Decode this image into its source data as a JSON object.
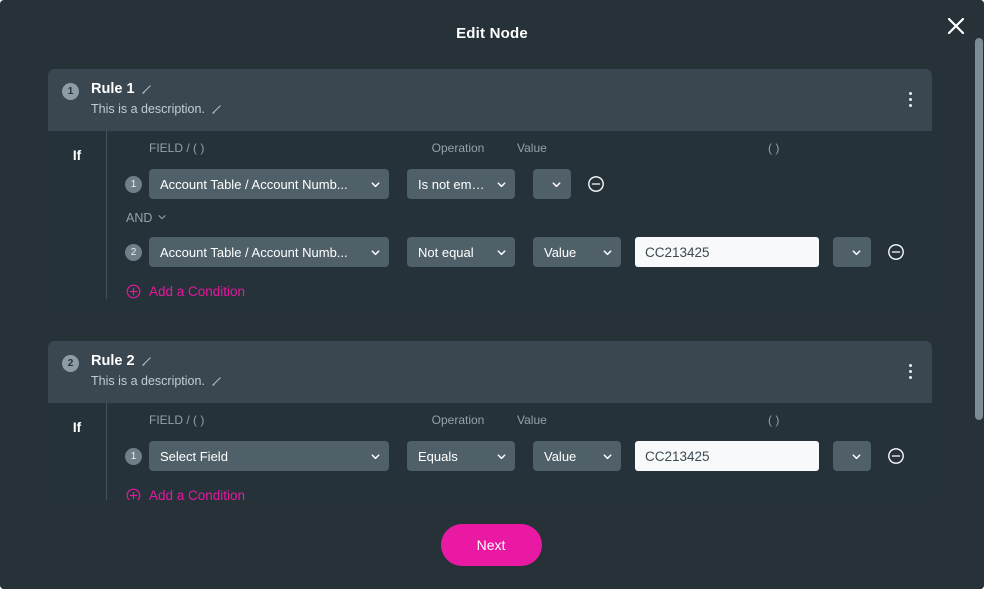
{
  "dialog": {
    "title": "Edit Node",
    "close_icon": "close-icon"
  },
  "colors": {
    "accent": "#ea19a3",
    "dialog_bg": "#263238",
    "rule_header_bg": "#3a4750",
    "select_bg": "#4f6069",
    "input_bg": "#f7f9fa"
  },
  "columns": {
    "field": "FIELD / ( )",
    "operation": "Operation",
    "value": "Value",
    "paren": "( )"
  },
  "if_label": "If",
  "add_condition_label": "Add a Condition",
  "connector": {
    "label": "AND"
  },
  "rules": [
    {
      "number": "1",
      "title": "Rule 1",
      "description": "This is a description.",
      "conditions": [
        {
          "number": "1",
          "field": "Account Table / Account Numb...",
          "operation": "Is not empty",
          "value_type": "",
          "value": "",
          "has_value_input": false,
          "value_type_is_chevron_only": true
        },
        {
          "number": "2",
          "field": "Account Table / Account Numb...",
          "operation": "Not equal",
          "value_type": "Value",
          "value": "CC213425",
          "has_value_input": true,
          "value_type_is_chevron_only": false
        }
      ]
    },
    {
      "number": "2",
      "title": "Rule 2",
      "description": "This is a description.",
      "conditions": [
        {
          "number": "1",
          "field": "Select Field",
          "operation": "Equals",
          "value_type": "Value",
          "value": "CC213425",
          "has_value_input": true,
          "value_type_is_chevron_only": false
        }
      ]
    }
  ],
  "footer": {
    "next_label": "Next"
  }
}
